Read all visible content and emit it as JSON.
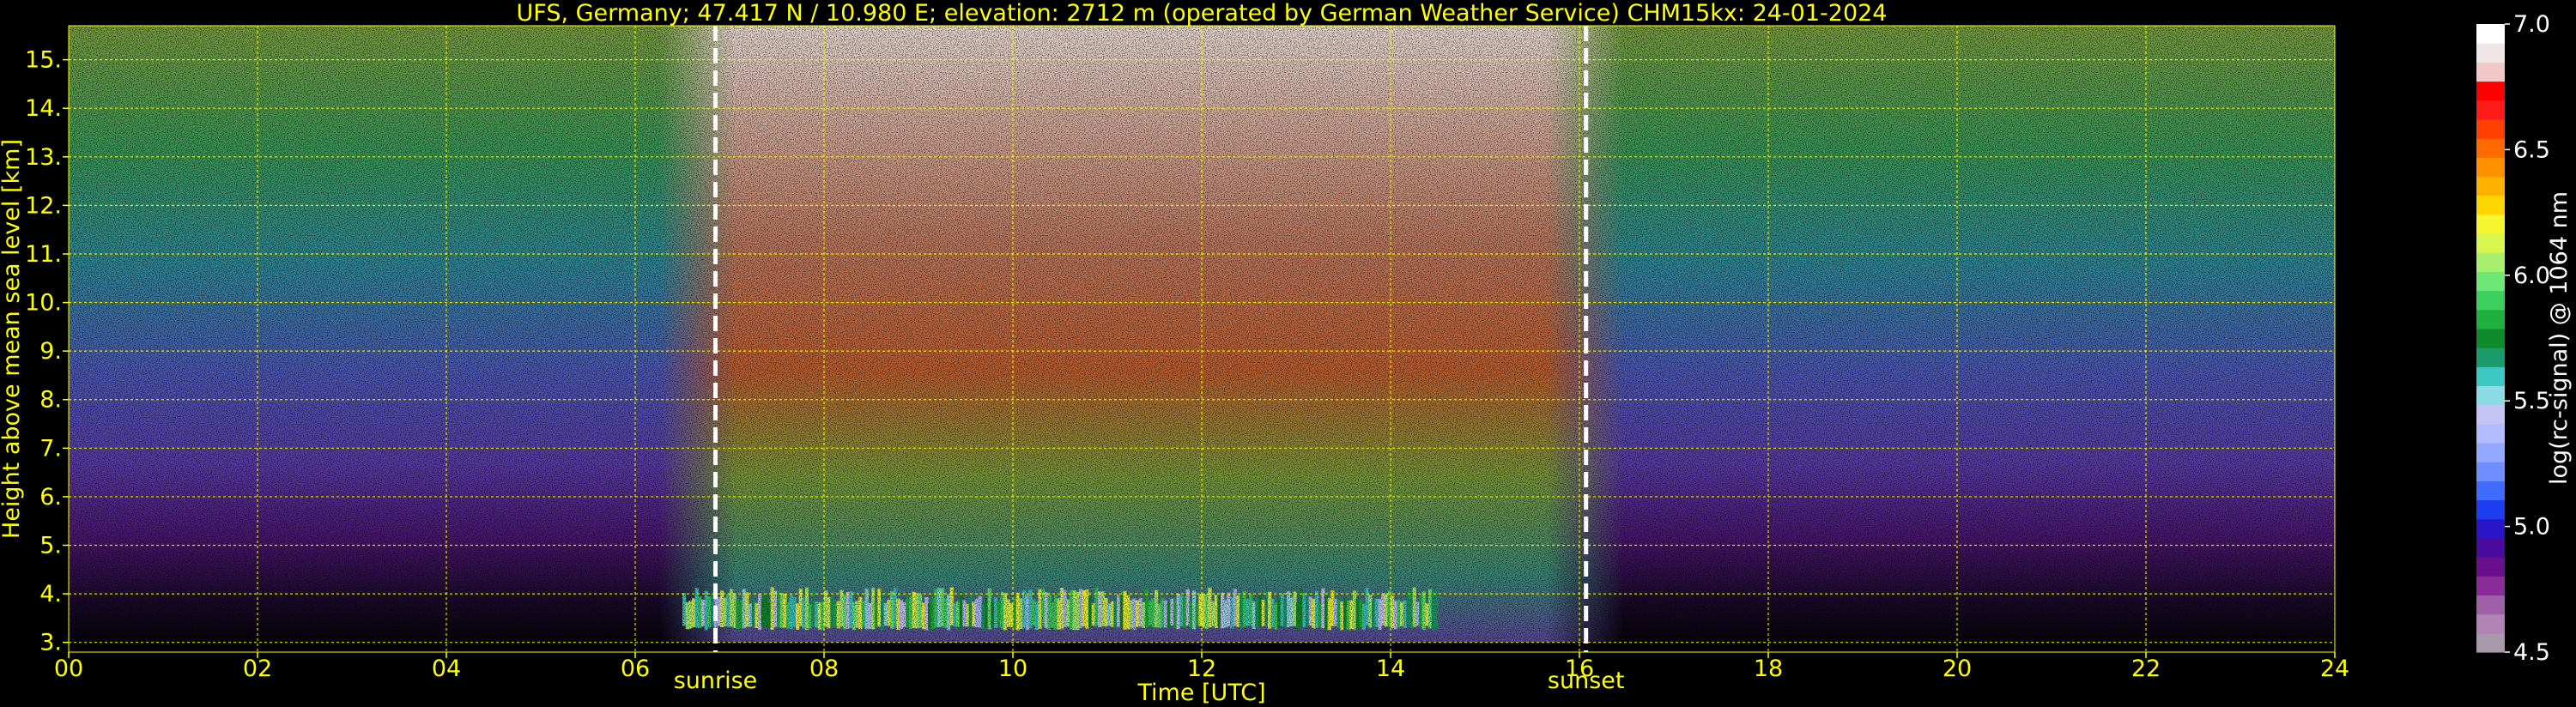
{
  "chart_data": {
    "type": "heatmap",
    "title": "UFS, Germany; 47.417 N / 10.980 E; elevation: 2712 m  (operated by German Weather Service)    CHM15kx: 24-01-2024",
    "xlabel": "Time [UTC]",
    "ylabel": "Height above mean sea level [km]",
    "xlim": [
      0,
      24
    ],
    "ylim": [
      2.8,
      15.7
    ],
    "x_ticks": [
      "00",
      "02",
      "04",
      "06",
      "08",
      "10",
      "12",
      "14",
      "16",
      "18",
      "20",
      "22",
      "24"
    ],
    "x_tick_values": [
      0,
      2,
      4,
      6,
      8,
      10,
      12,
      14,
      16,
      18,
      20,
      22,
      24
    ],
    "y_ticks": [
      "3.",
      "4.",
      "5.",
      "6.",
      "7.",
      "8.",
      "9.",
      "10.",
      "11.",
      "12.",
      "13.",
      "14.",
      "15."
    ],
    "y_tick_values": [
      3,
      4,
      5,
      6,
      7,
      8,
      9,
      10,
      11,
      12,
      13,
      14,
      15
    ],
    "grid": true,
    "markers": [
      {
        "label": "sunrise",
        "x": 6.85
      },
      {
        "label": "sunset",
        "x": 16.07
      }
    ],
    "colorbar": {
      "label": "log(rc-signal) @ 1064 nm",
      "range": [
        4.5,
        7.0
      ],
      "ticks": [
        "4.5",
        "5.0",
        "5.5",
        "6.0",
        "6.5",
        "7.0"
      ],
      "tick_values": [
        4.5,
        5.0,
        5.5,
        6.0,
        6.5,
        7.0
      ],
      "colors": [
        "#a89aac",
        "#b083b4",
        "#a060a8",
        "#8a2d9a",
        "#6a0f8e",
        "#4a0aa0",
        "#2a14c8",
        "#1e3cf0",
        "#3f6cff",
        "#6f8fff",
        "#93a8ff",
        "#b0bcff",
        "#c5c5f5",
        "#8cdce6",
        "#3cc8c0",
        "#1a9a6a",
        "#0f8a2a",
        "#20b040",
        "#3cd060",
        "#6ce878",
        "#a8f070",
        "#d8f550",
        "#f5f530",
        "#ffd700",
        "#ffb000",
        "#ff9000",
        "#ff6a00",
        "#ff4000",
        "#ff1a1a",
        "#ff0000",
        "#f0c8c8",
        "#f0e6e6",
        "#ffffff"
      ]
    },
    "layers": [
      {
        "description": "cloud layer",
        "x_range": [
          6.5,
          14.5
        ],
        "height_range": [
          3.3,
          4.0
        ],
        "value": 5.8
      }
    ],
    "colors": {
      "text": "#ffff00",
      "grid": "#ffff00",
      "background": "#000000",
      "markers": "#ffffff"
    }
  }
}
